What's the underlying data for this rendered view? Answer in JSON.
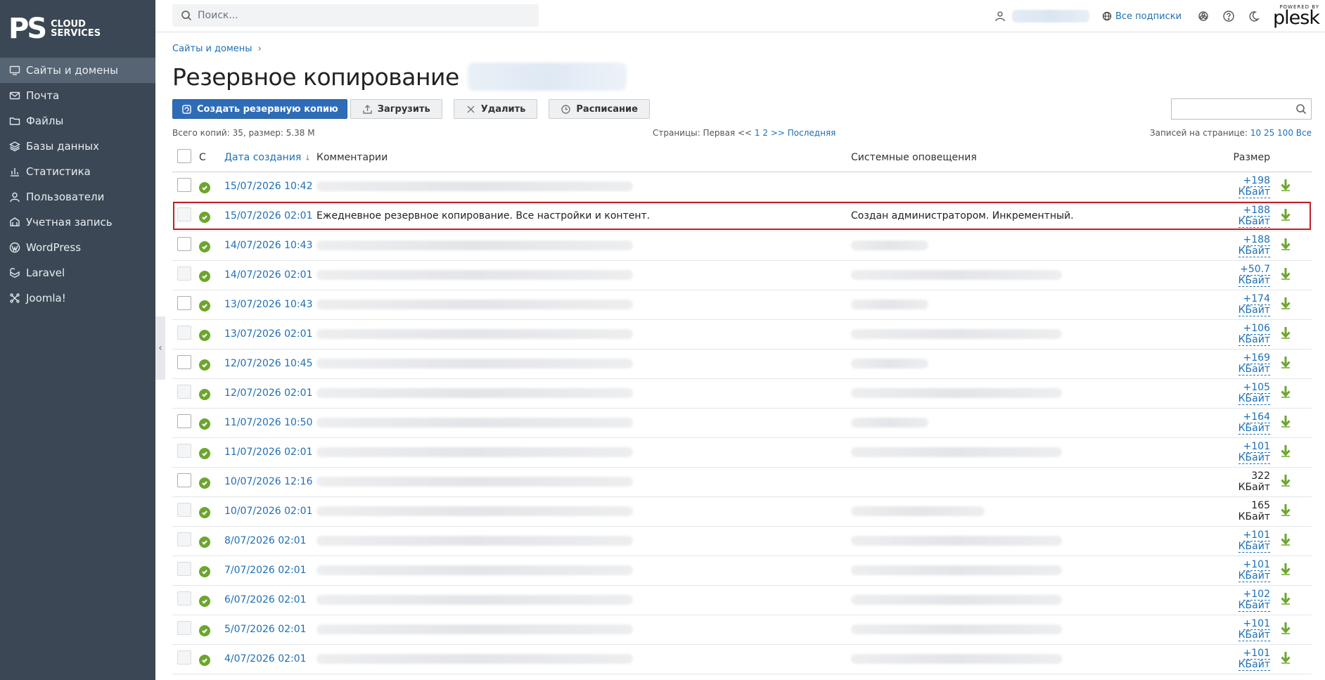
{
  "brand": {
    "mark": "PS",
    "line1": "CLOUD",
    "line2": "SERVICES"
  },
  "sidebar": {
    "items": [
      {
        "label": "Сайты и домены",
        "icon": "monitor-icon",
        "active": true
      },
      {
        "label": "Почта",
        "icon": "mail-icon"
      },
      {
        "label": "Файлы",
        "icon": "folder-icon"
      },
      {
        "label": "Базы данных",
        "icon": "layers-icon"
      },
      {
        "label": "Статистика",
        "icon": "bar-chart-icon"
      },
      {
        "label": "Пользователи",
        "icon": "user-icon"
      },
      {
        "label": "Учетная запись",
        "icon": "account-icon"
      },
      {
        "label": "WordPress",
        "icon": "wordpress-icon"
      },
      {
        "label": "Laravel",
        "icon": "laravel-icon"
      },
      {
        "label": "Joomla!",
        "icon": "joomla-icon"
      }
    ]
  },
  "topbar": {
    "search_placeholder": "Поиск...",
    "subscriptions": "Все подписки",
    "powered_by": "POWERED BY",
    "plesk": "plesk"
  },
  "breadcrumb": {
    "item": "Сайты и домены",
    "sep": "›"
  },
  "page": {
    "title": "Резервное копирование"
  },
  "toolbar": {
    "create": "Создать резервную копию",
    "upload": "Загрузить",
    "delete": "Удалить",
    "schedule": "Расписание"
  },
  "info": {
    "total": "Всего копий: 35, размер: 5.38 М",
    "pages_label": "Страницы: Первая <<",
    "page1": "1",
    "page2": "2",
    "pages_next": ">>",
    "pages_last": "Последняя",
    "per_page_label": "Записей на странице:",
    "pp10": "10",
    "pp25": "25",
    "pp100": "100",
    "ppall": "Все"
  },
  "table": {
    "headers": {
      "c": "С",
      "date": "Дата создания",
      "sort": "↓",
      "comments": "Комментарии",
      "notices": "Системные оповещения",
      "size": "Размер"
    },
    "rows": [
      {
        "date": "15/07/2026 10:42",
        "size": "+198 КБайт",
        "link": true,
        "cb": true,
        "cw": 450,
        "nw": 0
      },
      {
        "date": "15/07/2026 02:01",
        "size": "+188 КБайт",
        "link": true,
        "cb": false,
        "comment": "Ежедневное резервное копирование. Все настройки и контент.",
        "notice": "Создан администратором. Инкрементный.",
        "highlight": true
      },
      {
        "date": "14/07/2026 10:43",
        "size": "+188 КБайт",
        "link": true,
        "cb": true,
        "cw": 450,
        "nw": 110
      },
      {
        "date": "14/07/2026 02:01",
        "size": "+50.7 КБайт",
        "link": true,
        "cb": false,
        "cw": 450,
        "nw": 300
      },
      {
        "date": "13/07/2026 10:43",
        "size": "+174 КБайт",
        "link": true,
        "cb": true,
        "cw": 450,
        "nw": 110
      },
      {
        "date": "13/07/2026 02:01",
        "size": "+106 КБайт",
        "link": true,
        "cb": false,
        "cw": 450,
        "nw": 300
      },
      {
        "date": "12/07/2026 10:45",
        "size": "+169 КБайт",
        "link": true,
        "cb": true,
        "cw": 450,
        "nw": 110
      },
      {
        "date": "12/07/2026 02:01",
        "size": "+105 КБайт",
        "link": true,
        "cb": false,
        "cw": 450,
        "nw": 300
      },
      {
        "date": "11/07/2026 10:50",
        "size": "+164 КБайт",
        "link": true,
        "cb": true,
        "cw": 450,
        "nw": 110
      },
      {
        "date": "11/07/2026 02:01",
        "size": "+101 КБайт",
        "link": true,
        "cb": false,
        "cw": 450,
        "nw": 300
      },
      {
        "date": "10/07/2026 12:16",
        "size": "322 КБайт",
        "link": false,
        "cb": true,
        "cw": 450,
        "nw": 0
      },
      {
        "date": "10/07/2026 02:01",
        "size": "165 КБайт",
        "link": false,
        "cb": false,
        "cw": 450,
        "nw": 190
      },
      {
        "date": "8/07/2026 02:01",
        "size": "+101 КБайт",
        "link": true,
        "cb": false,
        "cw": 450,
        "nw": 300
      },
      {
        "date": "7/07/2026 02:01",
        "size": "+101 КБайт",
        "link": true,
        "cb": false,
        "cw": 450,
        "nw": 300
      },
      {
        "date": "6/07/2026 02:01",
        "size": "+102 КБайт",
        "link": true,
        "cb": false,
        "cw": 450,
        "nw": 300
      },
      {
        "date": "5/07/2026 02:01",
        "size": "+101 КБайт",
        "link": true,
        "cb": false,
        "cw": 450,
        "nw": 300
      },
      {
        "date": "4/07/2026 02:01",
        "size": "+101 КБайт",
        "link": true,
        "cb": false,
        "cw": 450,
        "nw": 300
      }
    ]
  },
  "colors": {
    "sidebar": "#3b4754",
    "accent": "#1e6fb5",
    "primary_button": "#2e6cb8",
    "success": "#6ca62d",
    "highlight": "#c0202a"
  }
}
